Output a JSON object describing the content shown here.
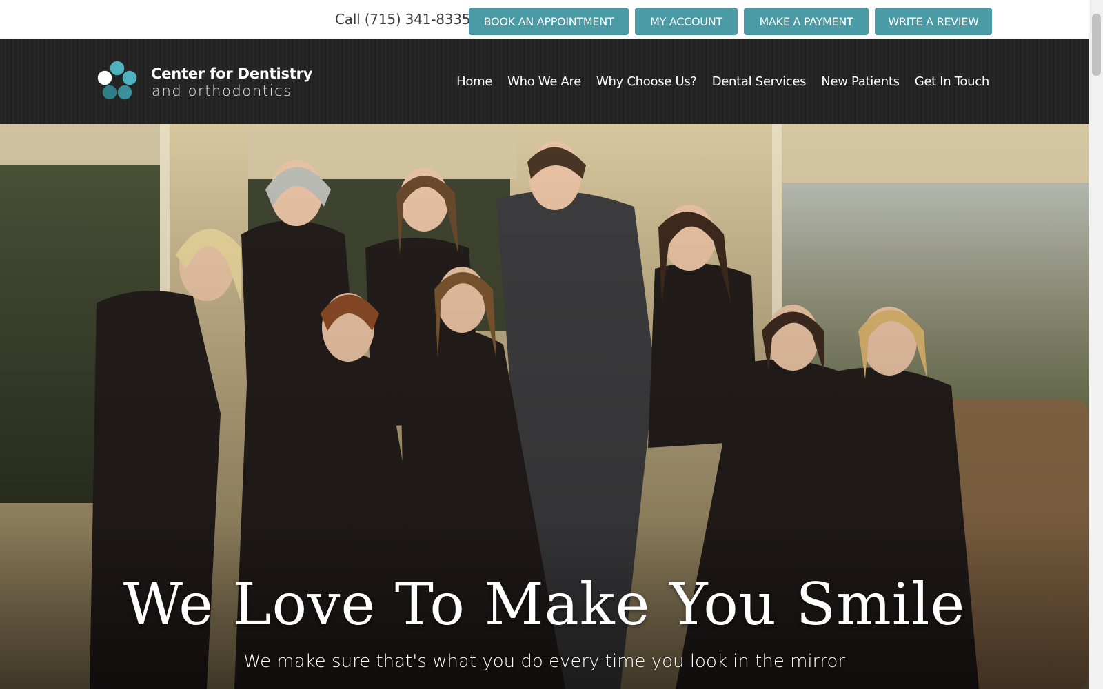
{
  "topbar": {
    "phone": "Call (715) 341-8335",
    "buttons": [
      "BOOK AN APPOINTMENT",
      "MY ACCOUNT",
      "MAKE A PAYMENT",
      "WRITE A REVIEW"
    ]
  },
  "brand": {
    "line1": "Center for Dentistry",
    "line2": "and orthodontics"
  },
  "nav": {
    "items": [
      "Home",
      "Who We Are",
      "Why Choose Us?",
      "Dental Services",
      "New Patients",
      "Get In Touch"
    ]
  },
  "hero": {
    "title": "We Love To Make You Smile",
    "subtitle": "We make sure that's what you do every time you look in the mirror"
  },
  "colors": {
    "accent": "#4a9ba6",
    "header_bg": "#232323",
    "logo_teal": "#4fb3bf",
    "logo_dark": "#2f7d86"
  }
}
